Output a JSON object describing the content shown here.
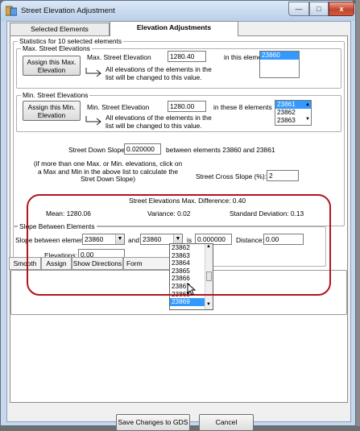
{
  "window": {
    "title": "Street Elevation Adjustment",
    "min_glyph": "—",
    "max_glyph": "□",
    "close_glyph": "x"
  },
  "tabs": [
    {
      "label": "Selected Elements"
    },
    {
      "label": "Elevation Adjustments"
    }
  ],
  "stats": {
    "legend": "Statistics for 10 selected elements",
    "max_group": {
      "legend": "Max. Street Elevations",
      "assign_button": "Assign this Max. Elevation",
      "field_label": "Max. Street Elevation",
      "value": "1280.40",
      "suffix": "in this element",
      "note": "All elevations of the elements in the list will be changed to this value.",
      "elements": [
        "23860"
      ]
    },
    "min_group": {
      "legend": "Min. Street Elevations",
      "assign_button": "Assign this Min. Elevation",
      "field_label": "Min. Street Elevation",
      "value": "1280.00",
      "suffix": "in these 8 elements",
      "note": "All elevations of the elements in the list will be changed to this value.",
      "elements": [
        "23861",
        "23862",
        "23863"
      ]
    },
    "down_slope": {
      "label": "Street Down Slope:",
      "value": "0.020000",
      "suffix": "between elements 23860 and 23861"
    },
    "hint": "(if more than one Max. or Min. elevations, click on a Max and Min in the above list to calculate the Stret Down Slope)",
    "cross_slope": {
      "label": "Street Cross Slope (%):",
      "value": "2"
    },
    "max_difference": "Street Elevations Max. Difference: 0.40",
    "mean": "Mean: 1280.06",
    "variance": "Variance: 0.02",
    "std_dev": "Standard Deviation: 0.13"
  },
  "slope_between": {
    "legend": "Slope Between Elements",
    "label": "Slope between elements",
    "element_a": "23860",
    "and_label": "and",
    "element_b": "23860",
    "is_label": "is",
    "slope_value": "0.000000",
    "distance_label": "Distance:",
    "distance_value": "0.00",
    "elevations_label": "Elevations:",
    "elevations_value": "0.00",
    "dropdown_options": [
      "23862",
      "23863",
      "23864",
      "23865",
      "23866",
      "23867",
      "23868",
      "23869"
    ],
    "selected_option": "23869"
  },
  "toolbar": {
    "smooth": "Smooth",
    "assign": "Assign",
    "show_directions": "Show Directions",
    "form": "Form"
  },
  "footer": {
    "save": "Save Changes to GDS",
    "cancel": "Cancel"
  },
  "colors": {
    "highlight": "#b0151c",
    "selection": "#3399ff"
  }
}
